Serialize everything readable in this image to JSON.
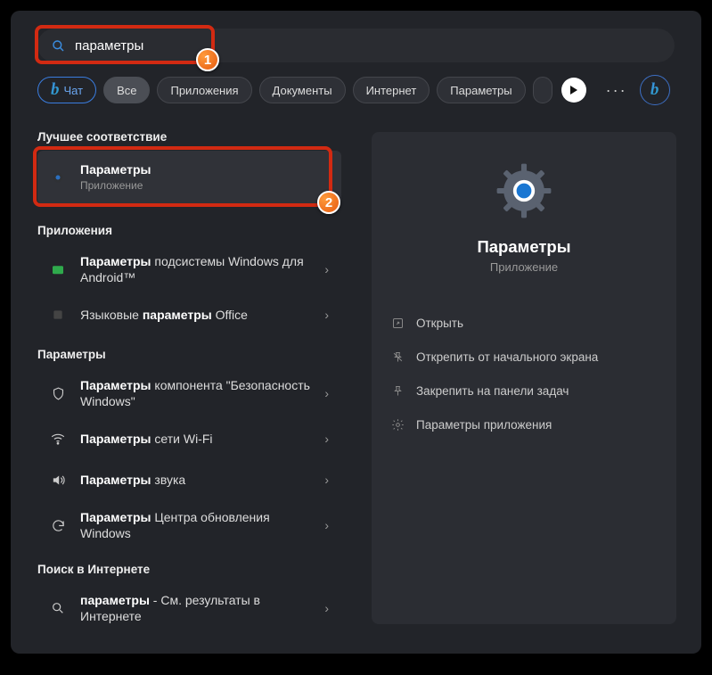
{
  "search": {
    "value": "параметры"
  },
  "filters": {
    "chat": "Чат",
    "all": "Все",
    "apps": "Приложения",
    "docs": "Документы",
    "web": "Интернет",
    "settings": "Параметры"
  },
  "annotations": {
    "one": "1",
    "two": "2"
  },
  "sections": {
    "best_match": "Лучшее соответствие",
    "apps": "Приложения",
    "settings": "Параметры",
    "web": "Поиск в Интернете"
  },
  "best": {
    "title": "Параметры",
    "subtitle": "Приложение"
  },
  "apps_results": [
    {
      "title_bold": "Параметры",
      "title_rest": " подсистемы Windows для Android™"
    },
    {
      "title_pre": "Языковые ",
      "title_bold": "параметры",
      "title_post": " Office"
    }
  ],
  "settings_results": [
    {
      "title_bold": "Параметры",
      "title_rest": " компонента \"Безопасность Windows\""
    },
    {
      "title_bold": "Параметры",
      "title_rest": " сети Wi-Fi"
    },
    {
      "title_bold": "Параметры",
      "title_rest": " звука"
    },
    {
      "title_bold": "Параметры",
      "title_rest": " Центра обновления Windows"
    }
  ],
  "web_results": [
    {
      "title_bold": "параметры",
      "title_rest": " - См. результаты в Интернете"
    }
  ],
  "detail": {
    "title": "Параметры",
    "subtitle": "Приложение",
    "actions": {
      "open": "Открыть",
      "unpin": "Открепить от начального экрана",
      "pin_task": "Закрепить на панели задач",
      "app_settings": "Параметры приложения"
    }
  }
}
